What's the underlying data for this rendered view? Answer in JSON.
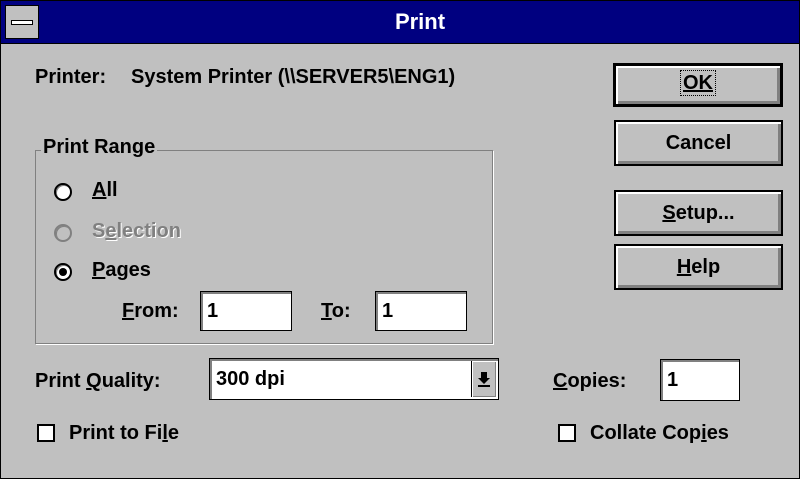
{
  "window": {
    "title": "Print"
  },
  "printer": {
    "label": "Printer:",
    "value": "System Printer (\\\\SERVER5\\ENG1)"
  },
  "buttons": {
    "ok": "OK",
    "cancel": "Cancel",
    "setup_pre": "",
    "setup_key": "S",
    "setup_post": "etup...",
    "help_pre": "",
    "help_key": "H",
    "help_post": "elp"
  },
  "print_range": {
    "legend": "Print Range",
    "all_key": "A",
    "all_post": "ll",
    "selection_pre": "S",
    "selection_key": "e",
    "selection_post": "lection",
    "pages_key": "P",
    "pages_post": "ages",
    "selected": "pages",
    "from_key": "F",
    "from_post": "rom:",
    "from_value": "1",
    "to_key": "T",
    "to_post": "o:",
    "to_value": "1"
  },
  "quality": {
    "label_pre": "Print ",
    "label_key": "Q",
    "label_post": "uality:",
    "value": "300 dpi"
  },
  "copies": {
    "label_key": "C",
    "label_post": "opies:",
    "value": "1"
  },
  "print_to_file": {
    "label_pre": "Print to Fi",
    "label_key": "l",
    "label_post": "e",
    "checked": false
  },
  "collate": {
    "label_pre": "Collate Cop",
    "label_key": "i",
    "label_post": "es",
    "checked": false
  },
  "icons": {
    "system_menu": "system-menu-icon",
    "dropdown": "dropdown-arrow-icon"
  }
}
